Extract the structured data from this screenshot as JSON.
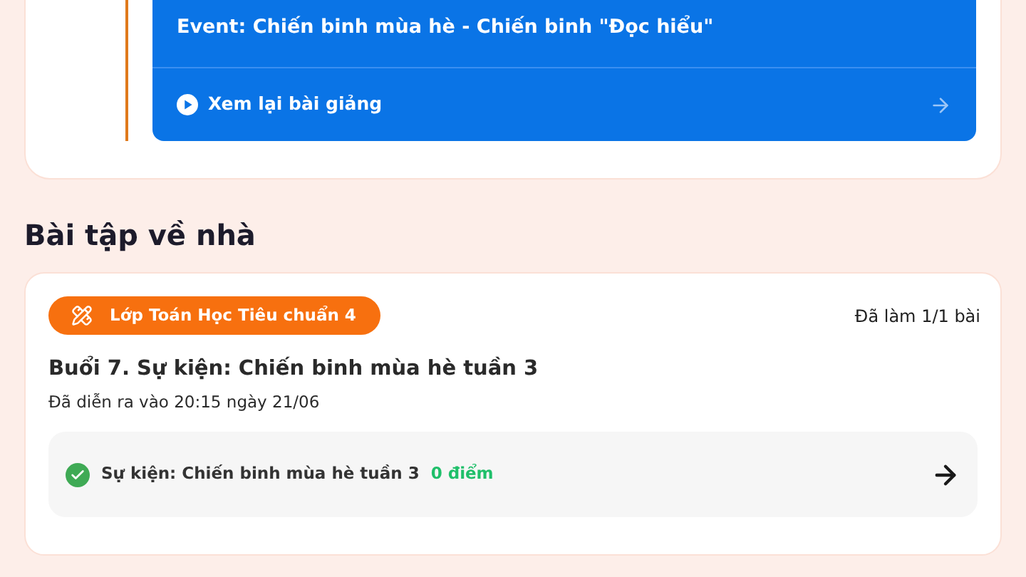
{
  "lesson_card": {
    "event_title": "Event: Chiến binh mùa hè - Chiến binh \"Đọc hiểu\"",
    "replay_link": "Xem lại bài giảng"
  },
  "homework": {
    "heading": "Bài tập về nhà",
    "card": {
      "class_badge": "Lớp Toán Học Tiêu chuẩn 4",
      "progress": "Đã làm 1/1 bài",
      "title": "Buổi 7. Sự kiện: Chiến binh mùa hè tuần 3",
      "date": "Đã diễn ra vào 20:15 ngày 21/06",
      "tasks": [
        {
          "name": "Sự kiện: Chiến binh mùa hè tuần 3",
          "score": "0 điểm",
          "completed": true
        }
      ]
    }
  }
}
